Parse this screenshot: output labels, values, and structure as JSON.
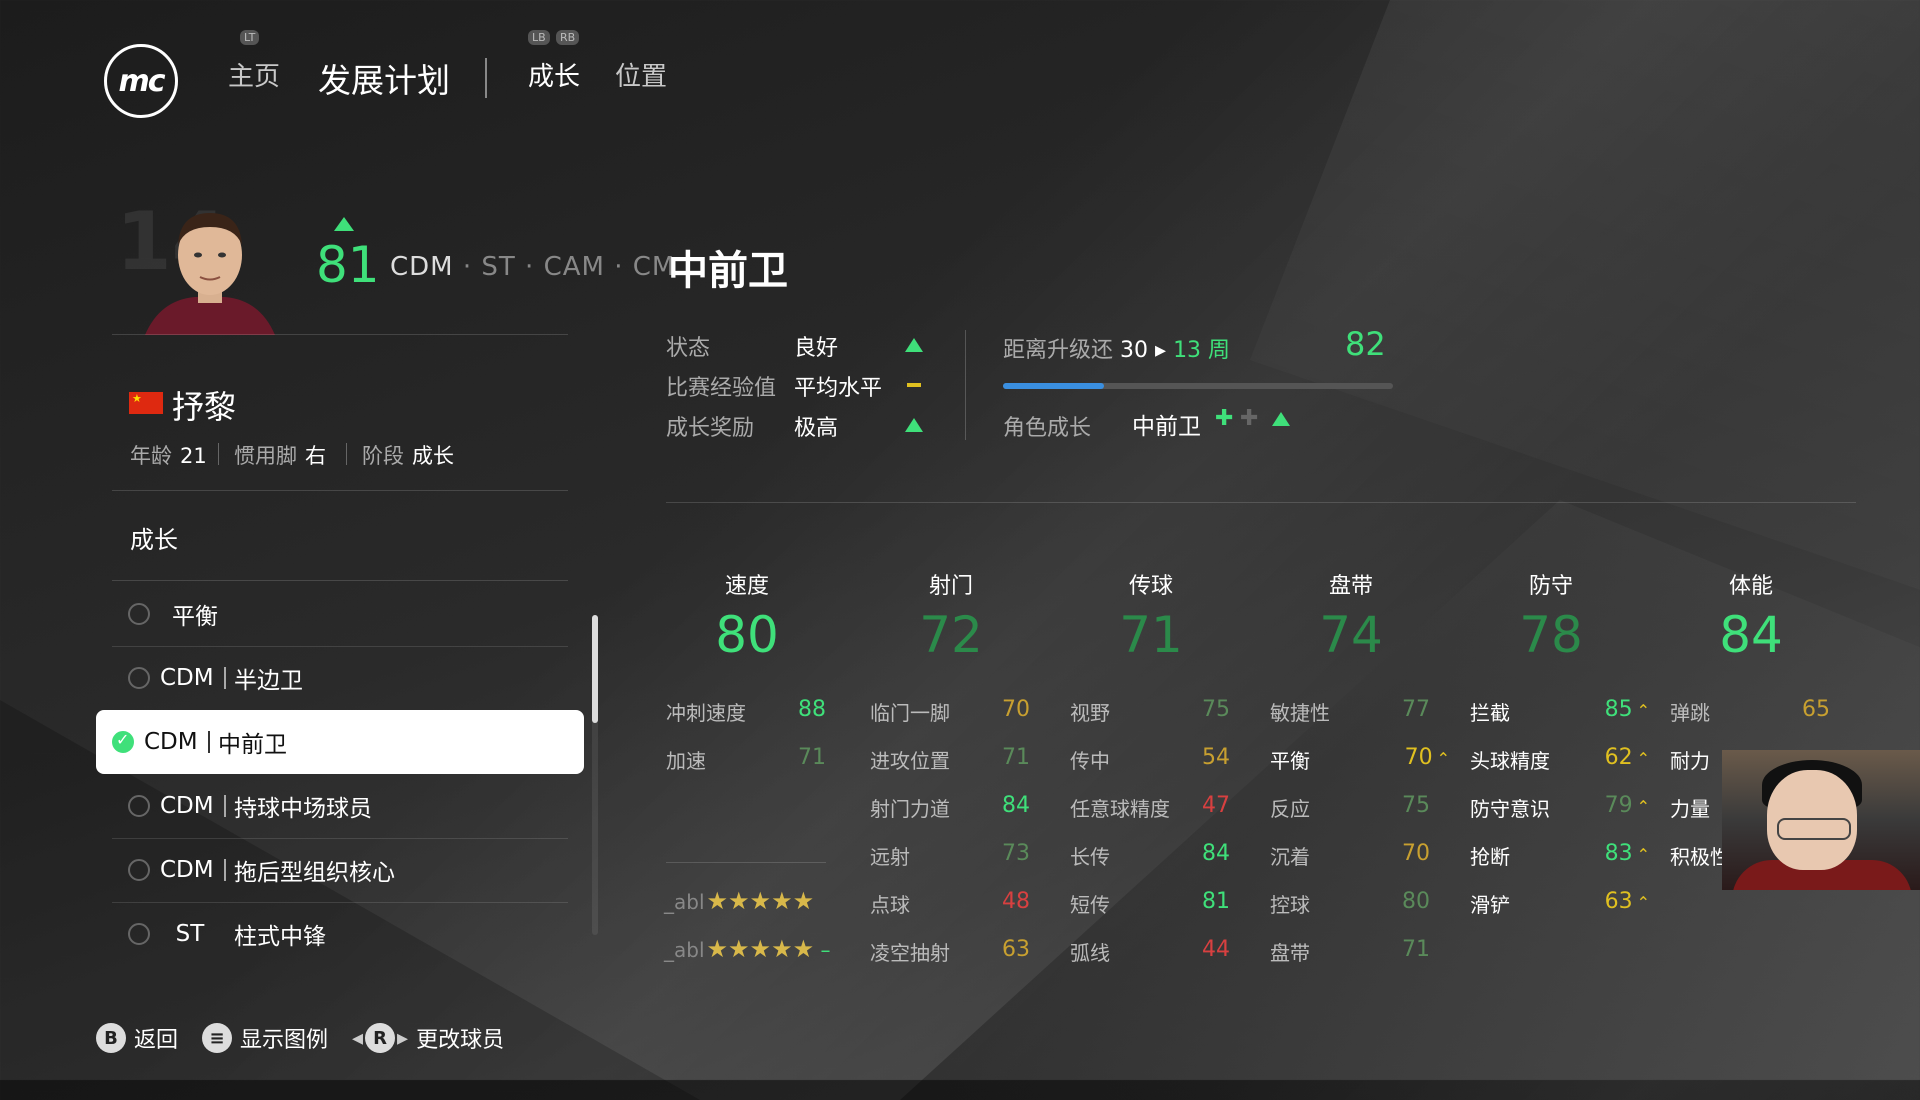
{
  "header": {
    "logo": "mc",
    "nav_home": "主页",
    "nav_plan": "发展计划",
    "nav_growth": "成长",
    "nav_position": "位置",
    "hint_lt": "LT",
    "hint_lb": "LB",
    "hint_rb": "RB"
  },
  "player": {
    "number": "14",
    "ovr": "81",
    "positions_main": "CDM",
    "positions_alt": "· ST · CAM · CM",
    "role_title": "中前卫",
    "name": "抒黎",
    "age_label": "年龄",
    "age": "21",
    "foot_label": "惯用脚",
    "foot": "右",
    "stage_label": "阶段",
    "stage": "成长"
  },
  "growth_list": {
    "title": "成长",
    "items": [
      {
        "pos": "",
        "role": "平衡"
      },
      {
        "pos": "CDM",
        "role": "半边卫"
      },
      {
        "pos": "CDM",
        "role": "中前卫"
      },
      {
        "pos": "CDM",
        "role": "持球中场球员"
      },
      {
        "pos": "CDM",
        "role": "拖后型组织核心"
      },
      {
        "pos": "ST",
        "role": "柱式中锋"
      }
    ]
  },
  "status": {
    "form_label": "状态",
    "form_value": "良好",
    "exp_label": "比赛经验值",
    "exp_value": "平均水平",
    "bonus_label": "成长奖励",
    "bonus_value": "极高",
    "upgrade_label": "距离升级还",
    "upgrade_from": "30",
    "upgrade_to": "13 周",
    "upgrade_target": "82",
    "upgrade_progress": 0.26,
    "role_growth_label": "角色成长",
    "role_growth_value": "中前卫"
  },
  "categories": [
    {
      "name": "速度",
      "value": "80"
    },
    {
      "name": "射门",
      "value": "72"
    },
    {
      "name": "传球",
      "value": "71"
    },
    {
      "name": "盘带",
      "value": "74"
    },
    {
      "name": "防守",
      "value": "78"
    },
    {
      "name": "体能",
      "value": "84"
    }
  ],
  "attributes": {
    "pace": [
      {
        "n": "冲刺速度",
        "v": "88"
      },
      {
        "n": "加速",
        "v": "71"
      }
    ],
    "shooting": [
      {
        "n": "临门一脚",
        "v": "70"
      },
      {
        "n": "进攻位置",
        "v": "71"
      },
      {
        "n": "射门力道",
        "v": "84"
      },
      {
        "n": "远射",
        "v": "73"
      },
      {
        "n": "点球",
        "v": "48"
      },
      {
        "n": "凌空抽射",
        "v": "63"
      }
    ],
    "passing": [
      {
        "n": "视野",
        "v": "75"
      },
      {
        "n": "传中",
        "v": "54"
      },
      {
        "n": "任意球精度",
        "v": "47"
      },
      {
        "n": "长传",
        "v": "84"
      },
      {
        "n": "短传",
        "v": "81"
      },
      {
        "n": "弧线",
        "v": "44"
      }
    ],
    "dribbling": [
      {
        "n": "敏捷性",
        "v": "77"
      },
      {
        "n": "平衡",
        "v": "70"
      },
      {
        "n": "反应",
        "v": "75"
      },
      {
        "n": "沉着",
        "v": "70"
      },
      {
        "n": "控球",
        "v": "80"
      },
      {
        "n": "盘带",
        "v": "71"
      }
    ],
    "defending": [
      {
        "n": "拦截",
        "v": "85"
      },
      {
        "n": "头球精度",
        "v": "62"
      },
      {
        "n": "防守意识",
        "v": "79"
      },
      {
        "n": "抢断",
        "v": "83"
      },
      {
        "n": "滑铲",
        "v": "63"
      }
    ],
    "physical": [
      {
        "n": "弹跳",
        "v": "65"
      },
      {
        "n": "耐力",
        "v": ""
      },
      {
        "n": "力量",
        "v": ""
      },
      {
        "n": "积极性",
        "v": ""
      }
    ]
  },
  "star_rows": [
    {
      "label": "_abl",
      "stars": "★★★★★"
    },
    {
      "label": "_abl",
      "stars": "★★★★★"
    }
  ],
  "footer": {
    "back_key": "B",
    "back": "返回",
    "legend_key": "≡",
    "legend": "显示图例",
    "change_key": "R",
    "change": "更改球员"
  }
}
